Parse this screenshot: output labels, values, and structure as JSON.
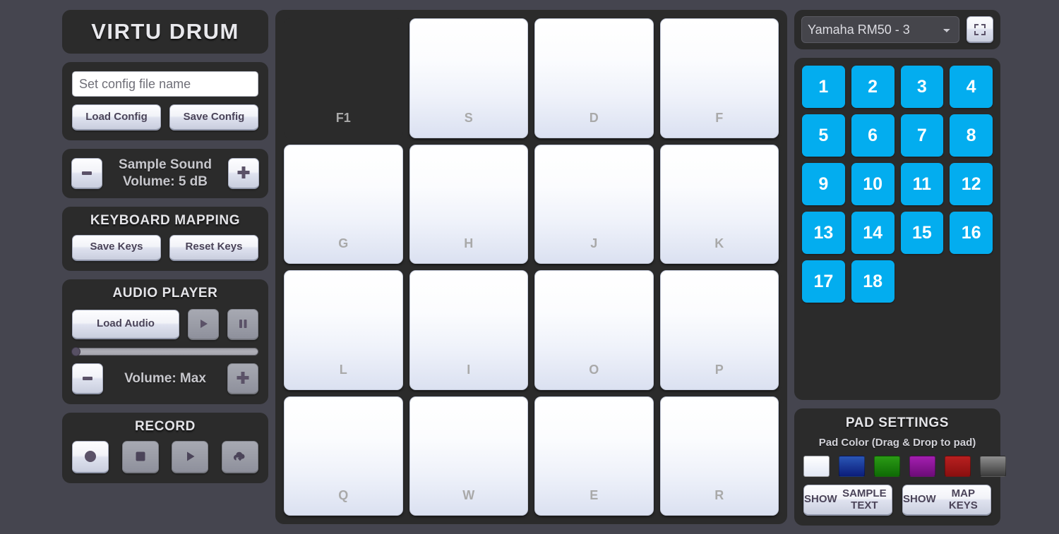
{
  "app": {
    "title": "VIRTU DRUM",
    "background_color": "#45454f",
    "panel_color": "#2b2b2b",
    "accent_color": "#03ADEF"
  },
  "config": {
    "input_value": "",
    "input_placeholder": "Set config file name",
    "load_label": "Load Config",
    "save_label": "Save Config"
  },
  "sample_volume": {
    "minus_glyph": "minus-icon",
    "plus_glyph": "plus-icon",
    "line1": "Sample Sound",
    "line2": "Volume: 5 dB"
  },
  "keyboard_mapping": {
    "heading": "KEYBOARD MAPPING",
    "save_label": "Save Keys",
    "reset_label": "Reset Keys"
  },
  "audio_player": {
    "heading": "AUDIO PLAYER",
    "load_label": "Load Audio",
    "play_glyph": "play-icon",
    "pause_glyph": "pause-icon",
    "progress_percent": 0,
    "volume_label": "Volume: Max",
    "minus_glyph": "minus-icon",
    "plus_glyph": "plus-icon"
  },
  "record": {
    "heading": "RECORD",
    "buttons": [
      {
        "name": "record",
        "glyph": "record-circle-icon",
        "enabled": true
      },
      {
        "name": "stop",
        "glyph": "stop-square-icon",
        "enabled": false
      },
      {
        "name": "play",
        "glyph": "play-icon",
        "enabled": false
      },
      {
        "name": "download",
        "glyph": "cloud-download-icon",
        "enabled": false
      }
    ]
  },
  "pads": [
    {
      "label": "F1",
      "empty": true
    },
    {
      "label": "S",
      "empty": false
    },
    {
      "label": "D",
      "empty": false
    },
    {
      "label": "F",
      "empty": false
    },
    {
      "label": "G",
      "empty": false
    },
    {
      "label": "H",
      "empty": false
    },
    {
      "label": "J",
      "empty": false
    },
    {
      "label": "K",
      "empty": false
    },
    {
      "label": "L",
      "empty": false
    },
    {
      "label": "I",
      "empty": false
    },
    {
      "label": "O",
      "empty": false
    },
    {
      "label": "P",
      "empty": false
    },
    {
      "label": "Q",
      "empty": false
    },
    {
      "label": "W",
      "empty": false
    },
    {
      "label": "E",
      "empty": false
    },
    {
      "label": "R",
      "empty": false
    }
  ],
  "kit": {
    "selected": "Yamaha RM50 - 3",
    "options": [
      "Yamaha RM50 - 3"
    ],
    "fullscreen_glyph": "fullscreen-icon"
  },
  "numpad": {
    "buttons": [
      "1",
      "2",
      "3",
      "4",
      "5",
      "6",
      "7",
      "8",
      "9",
      "10",
      "11",
      "12",
      "13",
      "14",
      "15",
      "16",
      "17",
      "18"
    ]
  },
  "pad_settings": {
    "heading": "PAD SETTINGS",
    "subheading": "Pad Color (Drag & Drop to pad)",
    "colors": [
      {
        "name": "white",
        "top": "#ffffff",
        "bottom": "#e3e8f5"
      },
      {
        "name": "blue",
        "top": "#2a56b5",
        "bottom": "#0b1d7a"
      },
      {
        "name": "green",
        "top": "#2b9b15",
        "bottom": "#0f6b05"
      },
      {
        "name": "purple",
        "top": "#a41fb0",
        "bottom": "#6d0c78"
      },
      {
        "name": "red",
        "top": "#b82020",
        "bottom": "#8a0f0f"
      },
      {
        "name": "gray",
        "top": "#8e8e8e",
        "bottom": "#3a3a3a"
      }
    ],
    "show_sample_text_line1": "SHOW",
    "show_sample_text_line2": "SAMPLE TEXT",
    "show_map_keys_line1": "SHOW",
    "show_map_keys_line2": "MAP KEYS"
  }
}
